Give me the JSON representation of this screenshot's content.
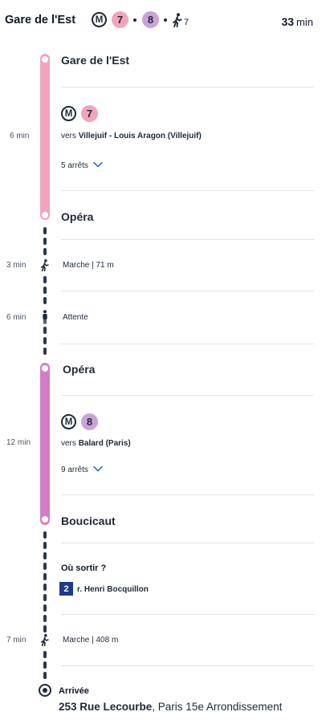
{
  "header": {
    "origin": "Gare de l'Est",
    "metro_symbol": "M",
    "lines": [
      {
        "label": "7",
        "color": "#f2a4bd"
      },
      {
        "label": "8",
        "color": "#c9a3d8"
      }
    ],
    "walk_icon": "walk-icon",
    "walk_count": "7",
    "duration_value": "33",
    "duration_unit": "min"
  },
  "segments": {
    "line7": {
      "color": "#f2a4bd",
      "duration": "6 min",
      "from_stop": "Gare de l'Est",
      "metro_symbol": "M",
      "line_label": "7",
      "direction_prefix": "vers",
      "direction": "Villejuif - Louis Aragon (Villejuif)",
      "stops_toggle": "5 arrêts",
      "to_stop": "Opéra"
    },
    "walk1": {
      "duration": "3 min",
      "label": "Marche | 71 m",
      "icon": "walk-icon"
    },
    "wait": {
      "duration": "6 min",
      "label": "Attente",
      "icon": "standing-person-icon"
    },
    "line8": {
      "color": "#d17fc8",
      "badge_color": "#c9a3d8",
      "duration": "12 min",
      "from_stop": "Opéra",
      "metro_symbol": "M",
      "line_label": "8",
      "direction_prefix": "vers",
      "direction": "Balard (Paris)",
      "stops_toggle": "9 arrêts",
      "to_stop": "Boucicaut"
    },
    "exit": {
      "title": "Où sortir ?",
      "number": "2",
      "street": "r. Henri Bocquillon"
    },
    "walk2": {
      "duration": "7 min",
      "label": "Marche | 408 m",
      "icon": "walk-icon"
    },
    "arrival": {
      "label": "Arrivée",
      "address_bold": "253 Rue Lecourbe",
      "address_rest": ", Paris 15e Arrondissement",
      "icon": "destination-icon"
    }
  },
  "accent_colors": {
    "chevron": "#1e5fbf",
    "exit_badge": "#1b3a8a"
  }
}
